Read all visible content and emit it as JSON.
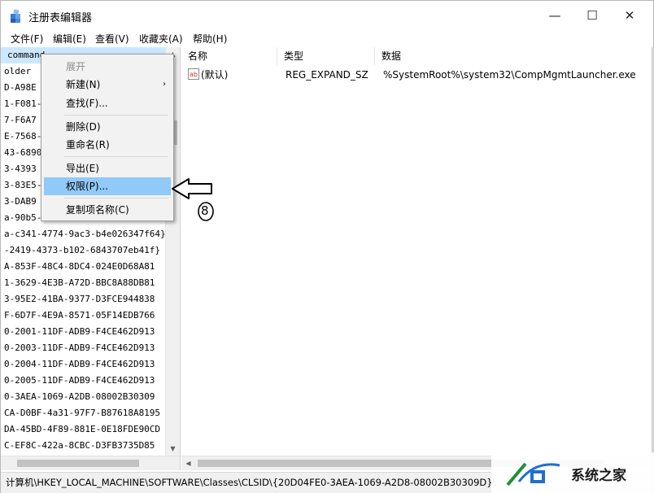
{
  "window": {
    "title": "注册表编辑器",
    "controls": {
      "minimize": "—",
      "maximize": "☐",
      "close": "✕"
    }
  },
  "menubar": [
    "文件(F)",
    "编辑(E)",
    "查看(V)",
    "收藏夹(A)",
    "帮助(H)"
  ],
  "tree": {
    "rows": [
      "command",
      "older",
      "D-A98E",
      "1-F081-",
      "7-F6A7",
      "E-7568-",
      "43-6890",
      "3-4393",
      "3-83E5-",
      "3-DAB9",
      "a-90b5-",
      "a-c341-4774-9ac3-b4e026347f64}",
      "-2419-4373-b102-6843707eb41f}",
      "A-853F-48C4-8DC4-024E0D68A81",
      "1-3629-4E3B-A72D-BBC8A88DB81",
      "3-95E2-41BA-9377-D3FCE944838",
      "F-6D7F-4E9A-8571-05F14EDB766",
      "0-2001-11DF-ADB9-F4CE462D913",
      "0-2003-11DF-ADB9-F4CE462D913",
      "0-2004-11DF-ADB9-F4CE462D913",
      "0-2005-11DF-ADB9-F4CE462D913",
      "0-3AEA-1069-A2DB-08002B30309",
      "CA-D0BF-4a31-97F7-B87618A8195",
      "DA-45BD-4F89-881E-0E18FDE90CD",
      "C-EF8C-422a-8CBC-D3FB3735D85"
    ]
  },
  "list": {
    "headers": {
      "name": "名称",
      "type": "类型",
      "data": "数据"
    },
    "rows": [
      {
        "name": "(默认)",
        "type": "REG_EXPAND_SZ",
        "data": "%SystemRoot%\\system32\\CompMgmtLauncher.exe"
      }
    ]
  },
  "context_menu": {
    "items": [
      {
        "label": "展开",
        "state": "disabled"
      },
      {
        "label": "新建(N)",
        "submenu": "›"
      },
      {
        "label": "查找(F)..."
      },
      {
        "label": "删除(D)"
      },
      {
        "label": "重命名(R)"
      },
      {
        "label": "导出(E)"
      },
      {
        "label": "权限(P)...",
        "state": "highlighted"
      },
      {
        "label": "复制项名称(C)"
      }
    ]
  },
  "status_path": "计算机\\HKEY_LOCAL_MACHINE\\SOFTWARE\\Classes\\CLSID\\{20D04FE0-3AEA-1069-A2D8-08002B30309D}\\",
  "annotation": {
    "step_number": "8"
  },
  "watermark": {
    "text": "系统之家"
  },
  "colors": {
    "selection": "#cce8ff",
    "menu_highlight": "#91c9f7",
    "disabled_text": "#8c8c8c"
  }
}
